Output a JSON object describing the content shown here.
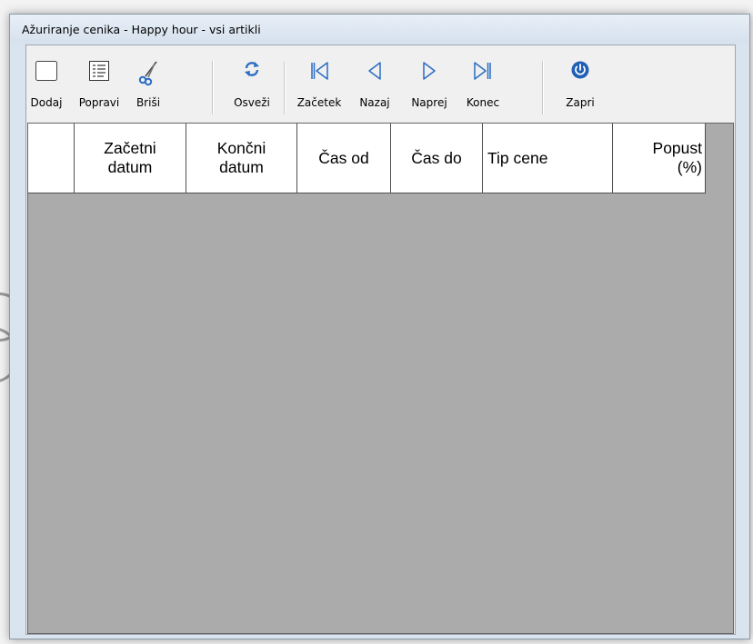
{
  "window": {
    "title": "Ažuriranje cenika - Happy hour - vsi artikli"
  },
  "toolbar": {
    "buttons": [
      {
        "label": "Dodaj",
        "icon": "blank-document-icon"
      },
      {
        "label": "Popravi",
        "icon": "edit-list-icon"
      },
      {
        "label": "Briši",
        "icon": "scissors-icon"
      },
      {
        "label": "Osveži",
        "icon": "refresh-icon"
      },
      {
        "label": "Začetek",
        "icon": "first-record-icon"
      },
      {
        "label": "Nazaj",
        "icon": "previous-record-icon"
      },
      {
        "label": "Naprej",
        "icon": "next-record-icon"
      },
      {
        "label": "Konec",
        "icon": "last-record-icon"
      },
      {
        "label": "Zapri",
        "icon": "power-icon"
      }
    ]
  },
  "grid": {
    "columns": [
      {
        "label": ""
      },
      {
        "label": "Začetni\ndatum"
      },
      {
        "label": "Končni\ndatum"
      },
      {
        "label": "Čas od"
      },
      {
        "label": "Čas do"
      },
      {
        "label": "Tip cene"
      },
      {
        "label": "Popust\n(%)"
      }
    ],
    "rows": []
  },
  "colors": {
    "accent_icon": "#2b6cc4",
    "window_frame": "#dae4ef",
    "client_bg": "#f0f0f0",
    "grid_empty": "#ababab"
  }
}
